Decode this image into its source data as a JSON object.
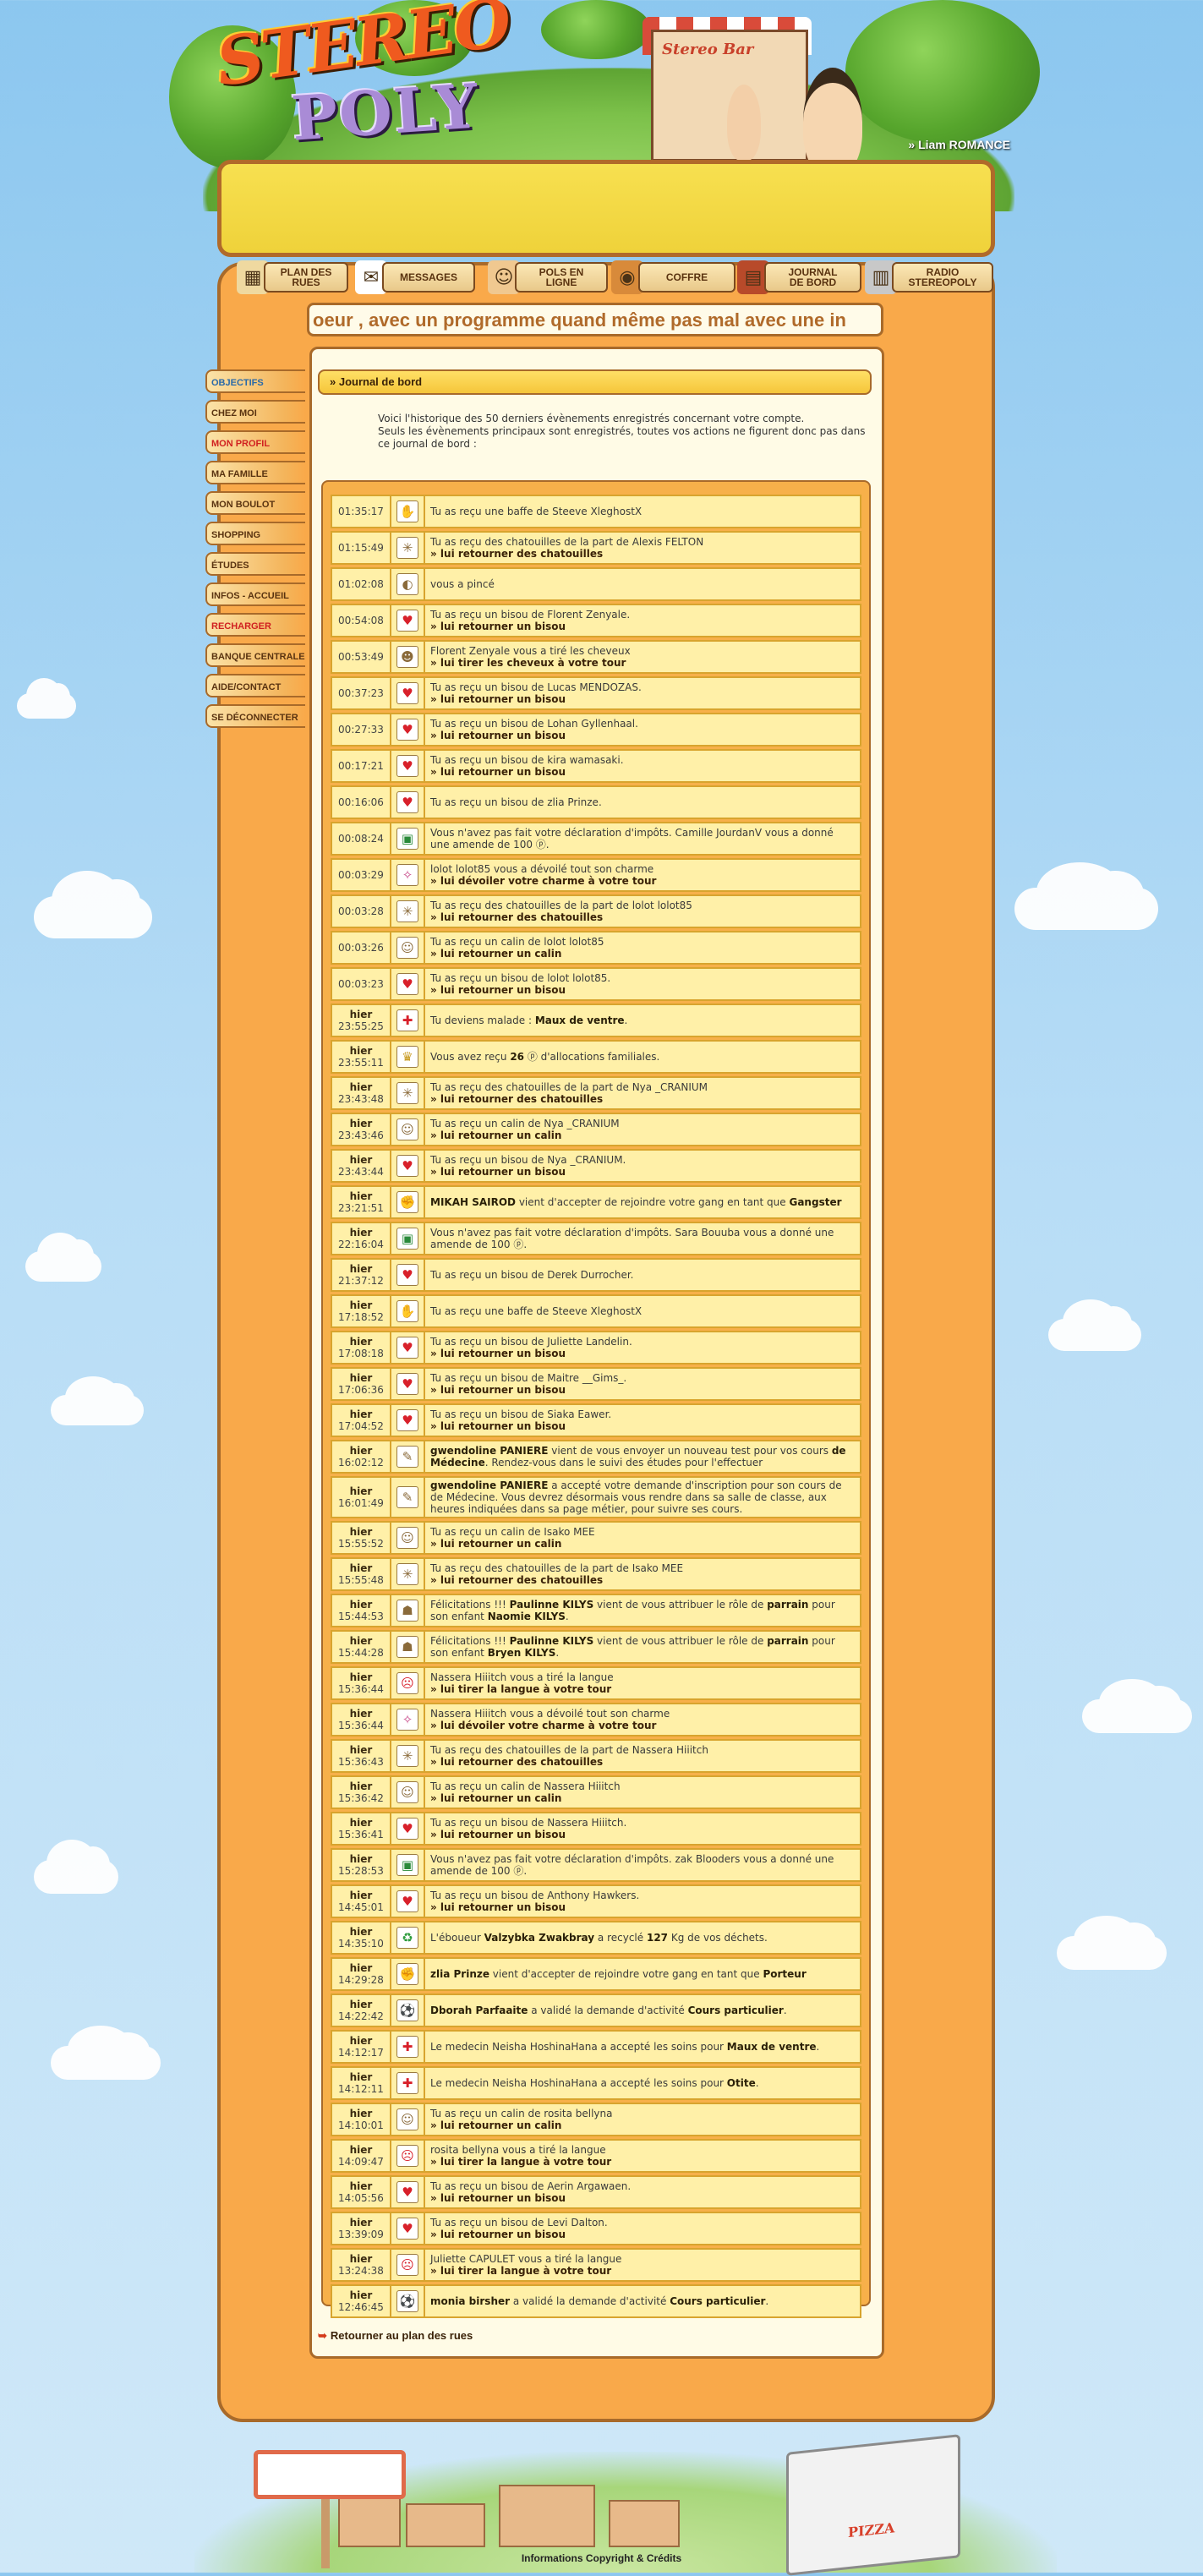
{
  "header": {
    "logo_top": "STEREO",
    "logo_bottom": "POLY",
    "shop_sign": "Stereo Bar",
    "username": "» Liam ROMANCE"
  },
  "nav": [
    {
      "label": "PLAN DES\nRUES",
      "icon": "map-icon"
    },
    {
      "label": "MESSAGES",
      "icon": "envelope-icon"
    },
    {
      "label": "POLS EN\nLIGNE",
      "icon": "people-icon"
    },
    {
      "label": "COFFRE",
      "icon": "safe-icon"
    },
    {
      "label": "JOURNAL\nDE BORD",
      "icon": "book-icon"
    },
    {
      "label": "RADIO\nSTEREOPOLY",
      "icon": "radio-icon"
    }
  ],
  "ticker": "oeur , avec un programme quand même pas mal avec une in",
  "sidebar": [
    {
      "label": "OBJECTIFS",
      "color": "#2a6aa8"
    },
    {
      "label": "CHEZ MOI",
      "color": "#5a3310"
    },
    {
      "label": "MON PROFIL",
      "color": "#d02020"
    },
    {
      "label": "MA FAMILLE",
      "color": "#5a3310"
    },
    {
      "label": "MON BOULOT",
      "color": "#5a3310"
    },
    {
      "label": "SHOPPING",
      "color": "#5a3310"
    },
    {
      "label": "ÉTUDES",
      "color": "#5a3310"
    },
    {
      "label": "INFOS - ACCUEIL",
      "color": "#5a3310"
    },
    {
      "label": "RECHARGER",
      "color": "#d02020"
    },
    {
      "label": "BANQUE CENTRALE",
      "color": "#5a3310"
    },
    {
      "label": "AIDE/CONTACT",
      "color": "#5a3310"
    },
    {
      "label": "SE DÉCONNECTER",
      "color": "#5a3310"
    }
  ],
  "section_title": "» Journal de bord",
  "intro": [
    "Voici l'historique des 50 derniers évènements enregistrés concernant votre compte.",
    "Seuls les évènements principaux sont enregistrés, toutes vos actions ne figurent donc pas dans ce journal de bord :"
  ],
  "log": [
    {
      "day": "",
      "time": "01:35:17",
      "icon": "slap-icon",
      "text": "Tu as reçu une baffe de Steeve XleghostX",
      "action": ""
    },
    {
      "day": "",
      "time": "01:15:49",
      "icon": "tickle-icon",
      "text": "Tu as reçu des chatouilles de la part de Alexis FELTON",
      "action": "» lui retourner des chatouilles"
    },
    {
      "day": "",
      "time": "01:02:08",
      "icon": "pinch-icon",
      "text": "vous a pincé",
      "action": ""
    },
    {
      "day": "",
      "time": "00:54:08",
      "icon": "kiss-icon",
      "text": "Tu as reçu un bisou de Florent Zenyale.",
      "action": "» lui retourner un bisou"
    },
    {
      "day": "",
      "time": "00:53:49",
      "icon": "hair-pull-icon",
      "text": "Florent Zenyale vous a tiré les cheveux",
      "action": "» lui tirer les cheveux à votre tour"
    },
    {
      "day": "",
      "time": "00:37:23",
      "icon": "kiss-icon",
      "text": "Tu as reçu un bisou de Lucas MENDOZAS.",
      "action": "» lui retourner un bisou"
    },
    {
      "day": "",
      "time": "00:27:33",
      "icon": "kiss-icon",
      "text": "Tu as reçu un bisou de Lohan Gyllenhaal.",
      "action": "» lui retourner un bisou"
    },
    {
      "day": "",
      "time": "00:17:21",
      "icon": "kiss-icon",
      "text": "Tu as reçu un bisou de kira wamasaki.",
      "action": "» lui retourner un bisou"
    },
    {
      "day": "",
      "time": "00:16:06",
      "icon": "kiss-icon",
      "text": "Tu as reçu un bisou de zlia Prinze.",
      "action": ""
    },
    {
      "day": "",
      "time": "00:08:24",
      "icon": "tax-icon",
      "text": "Vous n'avez pas fait votre déclaration d'impôts. Camille JourdanV vous a donné une amende de 100 ⓟ.",
      "action": ""
    },
    {
      "day": "",
      "time": "00:03:29",
      "icon": "charm-icon",
      "text": "lolot lolot85 vous a dévoilé tout son charme",
      "action": "» lui dévoiler votre charme à votre tour"
    },
    {
      "day": "",
      "time": "00:03:28",
      "icon": "tickle-icon",
      "text": "Tu as reçu des chatouilles de la part de lolot lolot85",
      "action": "» lui retourner des chatouilles"
    },
    {
      "day": "",
      "time": "00:03:26",
      "icon": "hug-icon",
      "text": "Tu as reçu un calin de lolot lolot85",
      "action": "» lui retourner un calin"
    },
    {
      "day": "",
      "time": "00:03:23",
      "icon": "kiss-icon",
      "text": "Tu as reçu un bisou de lolot lolot85.",
      "action": "» lui retourner un bisou"
    },
    {
      "day": "hier",
      "time": "23:55:25",
      "icon": "medical-cross-icon",
      "text": "Tu deviens malade : <b>Maux de ventre</b>.",
      "action": ""
    },
    {
      "day": "hier",
      "time": "23:55:11",
      "icon": "crown-icon",
      "text": "Vous avez reçu <b>26</b> ⓟ d'allocations familiales.",
      "action": ""
    },
    {
      "day": "hier",
      "time": "23:43:48",
      "icon": "tickle-icon",
      "text": "Tu as reçu des chatouilles de la part de Nya _CRANIUM",
      "action": "» lui retourner des chatouilles"
    },
    {
      "day": "hier",
      "time": "23:43:46",
      "icon": "hug-icon",
      "text": "Tu as reçu un calin de Nya _CRANIUM",
      "action": "» lui retourner un calin"
    },
    {
      "day": "hier",
      "time": "23:43:44",
      "icon": "kiss-icon",
      "text": "Tu as reçu un bisou de Nya _CRANIUM.",
      "action": "» lui retourner un bisou"
    },
    {
      "day": "hier",
      "time": "23:21:51",
      "icon": "gang-icon",
      "text": "<b>MIKAH SAIROD</b> vient d'accepter de rejoindre votre gang en tant que <b>Gangster</b>",
      "action": ""
    },
    {
      "day": "hier",
      "time": "22:16:04",
      "icon": "tax-icon",
      "text": "Vous n'avez pas fait votre déclaration d'impôts. Sara Bouuba vous a donné une amende de 100 ⓟ.",
      "action": ""
    },
    {
      "day": "hier",
      "time": "21:37:12",
      "icon": "kiss-icon",
      "text": "Tu as reçu un bisou de Derek Durrocher.",
      "action": ""
    },
    {
      "day": "hier",
      "time": "17:18:52",
      "icon": "slap-icon",
      "text": "Tu as reçu une baffe de Steeve XleghostX",
      "action": ""
    },
    {
      "day": "hier",
      "time": "17:08:18",
      "icon": "kiss-icon",
      "text": "Tu as reçu un bisou de Juliette Landelin.",
      "action": "» lui retourner un bisou"
    },
    {
      "day": "hier",
      "time": "17:06:36",
      "icon": "kiss-icon",
      "text": "Tu as reçu un bisou de Maitre __Gims_.",
      "action": "» lui retourner un bisou"
    },
    {
      "day": "hier",
      "time": "17:04:52",
      "icon": "kiss-icon",
      "text": "Tu as reçu un bisou de Siaka Eawer.",
      "action": "» lui retourner un bisou"
    },
    {
      "day": "hier",
      "time": "16:02:12",
      "icon": "study-icon",
      "text": "<b>gwendoline PANIERE</b> vient de vous envoyer un nouveau test pour vos cours <b>de Médecine</b>. Rendez-vous dans le suivi des études pour l'effectuer",
      "action": ""
    },
    {
      "day": "hier",
      "time": "16:01:49",
      "icon": "study-icon",
      "text": "<b>gwendoline PANIERE</b> a accepté votre demande d'inscription pour son cours de de Médecine. Vous devrez désormais vous rendre dans sa salle de classe, aux heures indiquées dans sa page métier, pour suivre ses cours.",
      "action": ""
    },
    {
      "day": "hier",
      "time": "15:55:52",
      "icon": "hug-icon",
      "text": "Tu as reçu un calin de Isako MEE",
      "action": "» lui retourner un calin"
    },
    {
      "day": "hier",
      "time": "15:55:48",
      "icon": "tickle-icon",
      "text": "Tu as reçu des chatouilles de la part de Isako MEE",
      "action": "» lui retourner des chatouilles"
    },
    {
      "day": "hier",
      "time": "15:44:53",
      "icon": "family-icon",
      "text": "Félicitations !!! <b>Paulinne KILYS</b> vient de vous attribuer le rôle de <b>parrain</b> pour son enfant <b>Naomie KILYS</b>.",
      "action": ""
    },
    {
      "day": "hier",
      "time": "15:44:28",
      "icon": "family-icon",
      "text": "Félicitations !!! <b>Paulinne KILYS</b> vient de vous attribuer le rôle de <b>parrain</b> pour son enfant <b>Bryen KILYS</b>.",
      "action": ""
    },
    {
      "day": "hier",
      "time": "15:36:44",
      "icon": "tongue-icon",
      "text": "Nassera Hiiitch vous a tiré la langue",
      "action": "» lui tirer la langue à votre tour"
    },
    {
      "day": "hier",
      "time": "15:36:44",
      "icon": "charm-icon",
      "text": "Nassera Hiiitch vous a dévoilé tout son charme",
      "action": "» lui dévoiler votre charme à votre tour"
    },
    {
      "day": "hier",
      "time": "15:36:43",
      "icon": "tickle-icon",
      "text": "Tu as reçu des chatouilles de la part de Nassera Hiiitch",
      "action": "» lui retourner des chatouilles"
    },
    {
      "day": "hier",
      "time": "15:36:42",
      "icon": "hug-icon",
      "text": "Tu as reçu un calin de Nassera Hiiitch",
      "action": "» lui retourner un calin"
    },
    {
      "day": "hier",
      "time": "15:36:41",
      "icon": "kiss-icon",
      "text": "Tu as reçu un bisou de Nassera Hiiitch.",
      "action": "» lui retourner un bisou"
    },
    {
      "day": "hier",
      "time": "15:28:53",
      "icon": "tax-icon",
      "text": "Vous n'avez pas fait votre déclaration d'impôts. zak Blooders vous a donné une amende de 100 ⓟ.",
      "action": ""
    },
    {
      "day": "hier",
      "time": "14:45:01",
      "icon": "kiss-icon",
      "text": "Tu as reçu un bisou de Anthony Hawkers.",
      "action": "» lui retourner un bisou"
    },
    {
      "day": "hier",
      "time": "14:35:10",
      "icon": "recycle-icon",
      "text": "L'éboueur <b>Valzybka Zwakbray</b> a recyclé <b>127</b> Kg de vos déchets.",
      "action": ""
    },
    {
      "day": "hier",
      "time": "14:29:28",
      "icon": "gang-icon",
      "text": "<b>zlia Prinze</b> vient d'accepter de rejoindre votre gang en tant que <b>Porteur</b>",
      "action": ""
    },
    {
      "day": "hier",
      "time": "14:22:42",
      "icon": "soccer-ball-icon",
      "text": "<b>Dborah Parfaaite</b> a validé la demande d'activité <b>Cours particulier</b>.",
      "action": ""
    },
    {
      "day": "hier",
      "time": "14:12:17",
      "icon": "medical-cross-icon",
      "text": "Le medecin Neisha HoshinaHana a accepté les soins pour <b>Maux de ventre</b>.",
      "action": ""
    },
    {
      "day": "hier",
      "time": "14:12:11",
      "icon": "medical-cross-icon",
      "text": "Le medecin Neisha HoshinaHana a accepté les soins pour <b>Otite</b>.",
      "action": ""
    },
    {
      "day": "hier",
      "time": "14:10:01",
      "icon": "hug-icon",
      "text": "Tu as reçu un calin de rosita bellyna",
      "action": "» lui retourner un calin"
    },
    {
      "day": "hier",
      "time": "14:09:47",
      "icon": "tongue-icon",
      "text": "rosita bellyna vous a tiré la langue",
      "action": "» lui tirer la langue à votre tour"
    },
    {
      "day": "hier",
      "time": "14:05:56",
      "icon": "kiss-icon",
      "text": "Tu as reçu un bisou de Aerin Argawaen.",
      "action": "» lui retourner un bisou"
    },
    {
      "day": "hier",
      "time": "13:39:09",
      "icon": "kiss-icon",
      "text": "Tu as reçu un bisou de Levi Dalton.",
      "action": "» lui retourner un bisou"
    },
    {
      "day": "hier",
      "time": "13:24:38",
      "icon": "tongue-icon",
      "text": "Juliette CAPULET vous a tiré la langue",
      "action": "» lui tirer la langue à votre tour"
    },
    {
      "day": "hier",
      "time": "12:46:45",
      "icon": "soccer-ball-icon",
      "text": "<b>monia birsher</b> a validé la demande d'activité <b>Cours particulier</b>.",
      "action": ""
    }
  ],
  "back_link": "Retourner au plan des rues",
  "footer_truck": "PIZZA",
  "footer_text": "Informations Copyright & Crédits",
  "icon_glyphs": {
    "slap-icon": "✋",
    "tickle-icon": "✳",
    "pinch-icon": "◐",
    "kiss-icon": "♥",
    "hair-pull-icon": "☻",
    "tax-icon": "▣",
    "charm-icon": "✧",
    "hug-icon": "☺",
    "medical-cross-icon": "✚",
    "crown-icon": "♛",
    "gang-icon": "✊",
    "study-icon": "✎",
    "family-icon": "☗",
    "tongue-icon": "☹",
    "recycle-icon": "♻",
    "soccer-ball-icon": "⚽"
  },
  "icon_colors": {
    "kiss-icon": "#d8202a",
    "medical-cross-icon": "#d8202a",
    "tax-icon": "#2a8a3a",
    "recycle-icon": "#2a9a3a",
    "gang-icon": "#222222",
    "soccer-ball-icon": "#111111",
    "crown-icon": "#c89a20",
    "tongue-icon": "#d8202a",
    "charm-icon": "#c84a8a"
  }
}
